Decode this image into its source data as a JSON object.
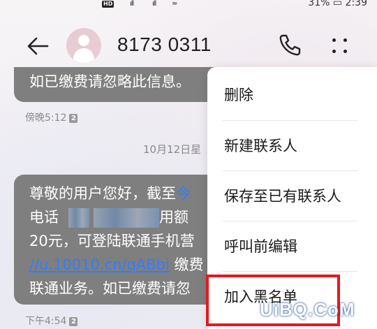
{
  "status_bar": {
    "hd_badge": "HD",
    "sim_number": "2",
    "right_text": "31%",
    "time": "2:39"
  },
  "header": {
    "title": "8173 0311"
  },
  "messages": [
    {
      "text_line": "如已缴费请忽略此信息。",
      "time": "傍晚5:12",
      "sim_badge": "2"
    }
  ],
  "date_divider": "10月12日星",
  "message2": {
    "line1_start": "尊敬的用户您好，截至",
    "line1_highlight": "今",
    "line2_start": "电话",
    "line2_end": "用额",
    "line3": "20元，可登陆联通手机营",
    "line4_link": "//u.10010.cn/qABbi",
    "line4_end": " 缴费",
    "line5": "联通业务。如已缴费请忽",
    "time": "下午4:54",
    "sim_badge": "2"
  },
  "menu": {
    "items": [
      {
        "label": "删除"
      },
      {
        "label": "新建联系人"
      },
      {
        "label": "保存至已有联系人"
      },
      {
        "label": "呼叫前编辑"
      },
      {
        "label": "加入黑名单"
      }
    ]
  },
  "watermark": "UiBQ.CoM",
  "colors": {
    "bubble": "#7f7f7f",
    "link": "#2f7dff",
    "highlight_box": "#e8181e"
  }
}
